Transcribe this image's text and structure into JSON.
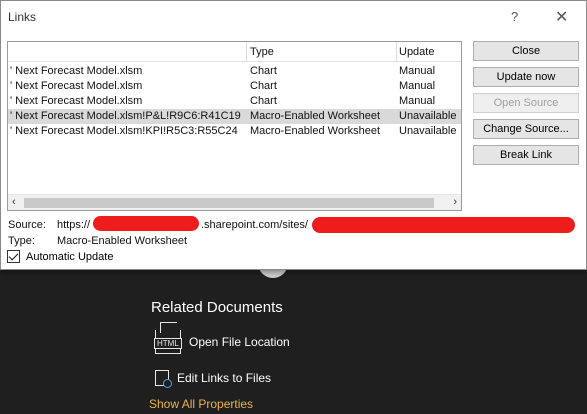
{
  "background": {
    "related_title": "Related Documents",
    "open_file_location": "Open File Location",
    "html_icon_text": "HTML",
    "edit_links": "Edit Links to Files",
    "show_all": "Show All Properties"
  },
  "dialog": {
    "title": "Links",
    "help": "?",
    "close": "✕",
    "columns": {
      "type": "Type",
      "update": "Update"
    },
    "rows": [
      {
        "source": "' Next Forecast Model.xlsm",
        "type": "Chart",
        "update": "Manual"
      },
      {
        "source": "' Next Forecast Model.xlsm",
        "type": "Chart",
        "update": "Manual"
      },
      {
        "source": "' Next Forecast Model.xlsm",
        "type": "Chart",
        "update": "Manual"
      },
      {
        "source": "' Next Forecast Model.xlsm!P&L!R9C6:R41C19",
        "type": "Macro-Enabled Worksheet",
        "update": "Unavailable",
        "selected": true
      },
      {
        "source": "' Next Forecast Model.xlsm!KPI!R5C3:R55C24",
        "type": "Macro-Enabled Worksheet",
        "update": "Unavailable"
      }
    ],
    "buttons": {
      "close": "Close",
      "update_now": "Update now",
      "open_source": "Open Source",
      "change_source": "Change Source...",
      "break_link": "Break Link"
    },
    "source_label": "Source:",
    "source_prefix": "https://",
    "source_mid": ".sharepoint.com/sites/",
    "type_label": "Type:",
    "type_value": "Macro-Enabled Worksheet",
    "automatic_update": "Automatic Update"
  },
  "colors": {
    "accent_link": "#e8b54a",
    "redaction": "#ee1c1c",
    "selected_row": "#d9d9d9"
  }
}
